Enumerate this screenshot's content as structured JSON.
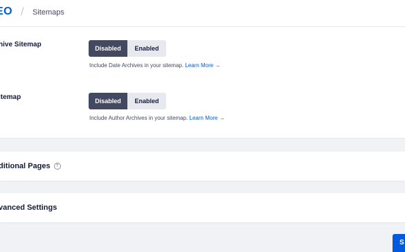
{
  "header": {
    "logo_text": "EO",
    "separator": "/",
    "breadcrumb": "Sitemaps"
  },
  "settings": [
    {
      "label": "hive Sitemap",
      "options": [
        "Disabled",
        "Enabled"
      ],
      "selected": "Disabled",
      "description_prefix": "Include Date Archives in your sitemap.",
      "learn_more": "Learn More →"
    },
    {
      "label": "itemap",
      "options": [
        "Disabled",
        "Enabled"
      ],
      "selected": "Disabled",
      "description_prefix": "Include Author Archives in your sitemap.",
      "learn_more": "Learn More →"
    }
  ],
  "sections": {
    "additional_pages": "ditional Pages",
    "advanced_settings": "vanced Settings"
  },
  "footer": {
    "save_label": "S"
  },
  "colors": {
    "accent": "#005ae0",
    "toggle_active": "#434960",
    "background": "#f1f2f5"
  },
  "icons": {
    "help": "help-circle-icon",
    "arrow": "arrow-right-icon"
  }
}
